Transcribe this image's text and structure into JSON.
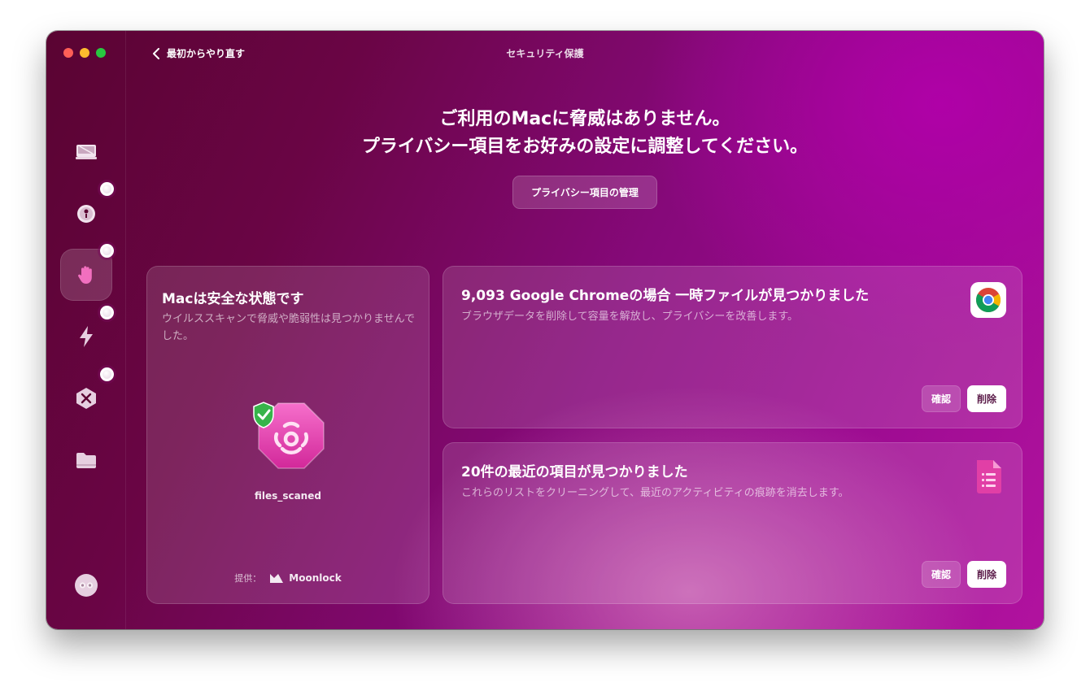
{
  "window": {
    "title": "セキュリティ保護",
    "back_label": "最初からやり直す"
  },
  "sidebar": {
    "items": [
      {
        "icon": "disk-icon",
        "badge": false
      },
      {
        "icon": "protection-icon",
        "badge": true
      },
      {
        "icon": "privacy-hand-icon",
        "badge": true,
        "active": true
      },
      {
        "icon": "performance-icon",
        "badge": true
      },
      {
        "icon": "applications-icon",
        "badge": true
      },
      {
        "icon": "folder-icon",
        "badge": false
      }
    ],
    "footer_icon": "assistant-icon"
  },
  "hero": {
    "line1": "ご利用のMacに脅威はありません。",
    "line2": "プライバシー項目をお好みの設定に調整してください。",
    "manage_button": "プライバシー項目の管理"
  },
  "safe_card": {
    "title": "Macは安全な状態です",
    "description": "ウイルススキャンで脅威や脆弱性は見つかりませんでした。",
    "files_label": "files_scaned",
    "provider_label": "提供：",
    "provider_name": "Moonlock"
  },
  "chrome_card": {
    "title": "9,093 Google Chromeの場合 一時ファイルが見つかりました",
    "description": "ブラウザデータを削除して容量を解放し、プライバシーを改善します。",
    "review_button": "確認",
    "delete_button": "削除"
  },
  "recent_card": {
    "title": "20件の最近の項目が見つかりました",
    "description": "これらのリストをクリーニングして、最近のアクティビティの痕跡を消去します。",
    "review_button": "確認",
    "delete_button": "削除"
  },
  "colors": {
    "accent": "#e13fa6",
    "window_dark": "#5a0432",
    "window_light": "#b1129f",
    "shield_green": "#37b44a"
  }
}
